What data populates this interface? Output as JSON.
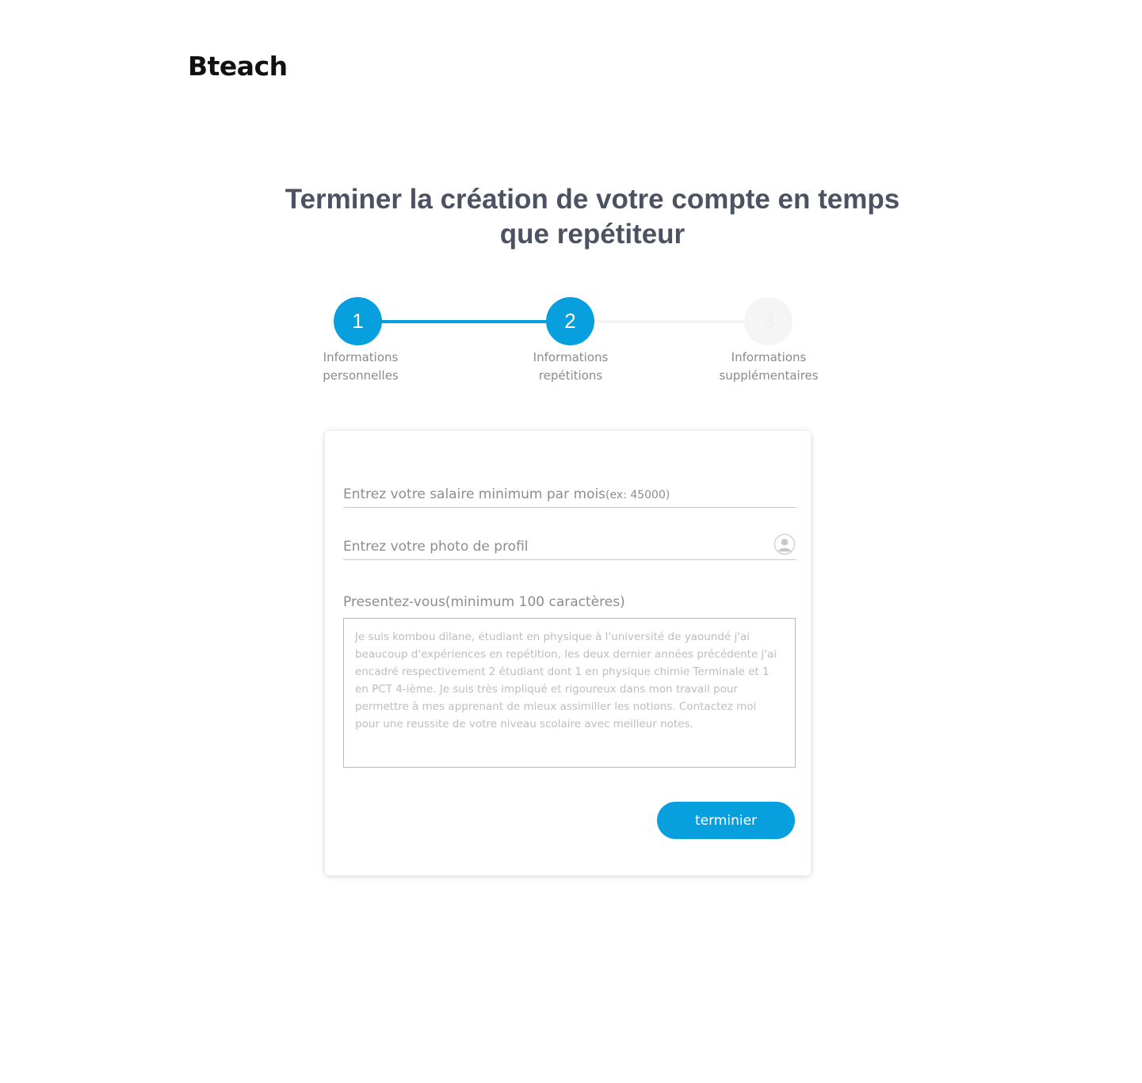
{
  "brand": {
    "logo_text": "Bteach"
  },
  "page": {
    "title": "Terminer la création de votre compte en temps que repétiteur"
  },
  "stepper": {
    "current_step": 2,
    "steps": [
      {
        "number": "1",
        "label": "Informations\npersonnelles",
        "state": "completed"
      },
      {
        "number": "2",
        "label": "Informations\nrepétitions",
        "state": "active"
      },
      {
        "number": "3",
        "label": "Informations\nsupplémentaires",
        "state": "pending"
      }
    ]
  },
  "form": {
    "salary": {
      "placeholder": "Entrez votre salaire minimum par mois",
      "hint": "(ex: 45000)"
    },
    "photo": {
      "placeholder": "Entrez votre photo de profil",
      "icon": "user-avatar-icon"
    },
    "bio": {
      "label": "Presentez-vous(minimum 100 caractères)",
      "value": "Je suis kombou dilane, étudiant en physique à l'université de yaoundé  j'ai beaucoup d'expériences en repétition, les deux dernier années précédente j'ai encadré respectivement 2 étudiant dont 1 en physique chimie Terminale et 1 en PCT 4-ième. Je suis très impliqué et rigoureux dans mon travail pour permettre à mes apprenant de mieux assimiller les notions. Contactez moi pour une reussite de votre niveau scolaire avec meilleur notes."
    },
    "submit_label": "terminier"
  },
  "colors": {
    "accent": "#089fdf",
    "title": "#4d5262",
    "muted_text": "#8d8d8d",
    "pending_step": "#f5f5f5"
  }
}
